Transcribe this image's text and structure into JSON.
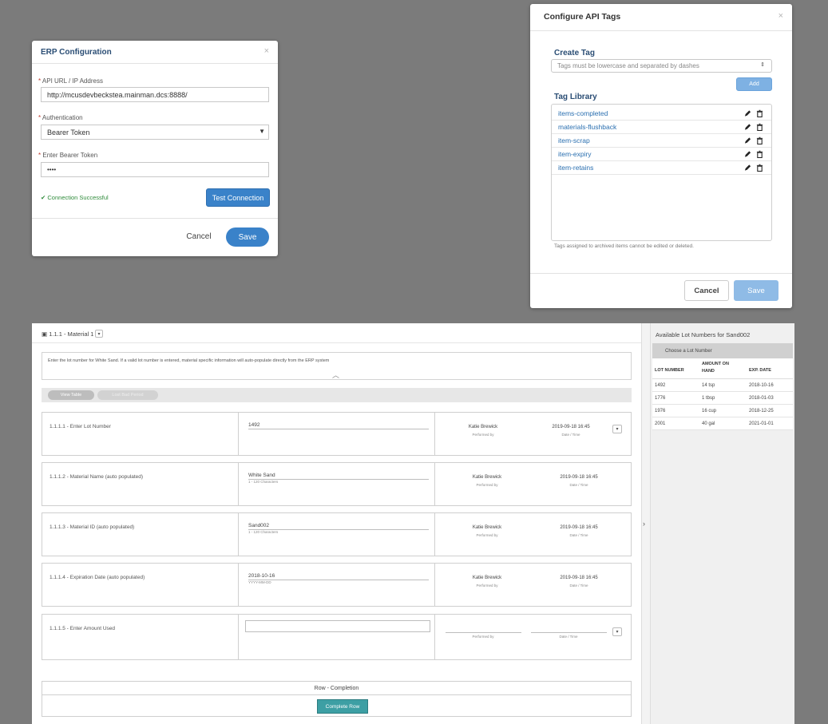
{
  "erp": {
    "title": "ERP Configuration",
    "close": "×",
    "api_label": "API URL / IP Address",
    "api_value": "http://mcusdevbeckstea.mainman.dcs:8888/",
    "auth_label": "Authentication",
    "auth_value": "Bearer Token",
    "token_label": "Enter Bearer Token",
    "token_value": "••••",
    "status": "Connection Successful",
    "test_button": "Test Connection",
    "cancel_button": "Cancel",
    "save_button": "Save",
    "required_mark": "*",
    "accent": "#3a82c9",
    "success_color": "#2e8b3a"
  },
  "tags": {
    "title": "Configure API Tags",
    "close": "×",
    "create_label": "Create Tag",
    "create_placeholder": "Tags must be lowercase and separated by dashes",
    "add_button": "Add",
    "library_label": "Tag Library",
    "items": [
      {
        "label": "items-completed"
      },
      {
        "label": "materials-flushback"
      },
      {
        "label": "item-scrap"
      },
      {
        "label": "item-expiry"
      },
      {
        "label": "item-retains"
      }
    ],
    "note": "Tags assigned to archived items cannot be edited or deleted.",
    "cancel_button": "Cancel",
    "save_button": "Save"
  },
  "workflow": {
    "header": "1.1.1 - Material 1",
    "instruction": "Enter the lot number for White Sand. If a valid lot number is entered, material specific information will auto-populate directly from the ERP system",
    "view_table": "View Table",
    "lot_button": "Lost Bad Period",
    "steps": [
      {
        "label": "1.1.1.1 - Enter Lot Number",
        "value": "1492",
        "hint": "",
        "user": "Katie Brewick",
        "user_sub": "Performed by",
        "date": "2019-09-18 16:45",
        "date_sub": "Date / Time"
      },
      {
        "label": "1.1.1.2 - Material Name (auto populated)",
        "value": "White Sand",
        "hint": "1 - 120 Characters",
        "user": "Katie Brewick",
        "user_sub": "Performed by",
        "date": "2019-09-18 16:45",
        "date_sub": "Date / Time"
      },
      {
        "label": "1.1.1.3 - Material ID (auto populated)",
        "value": "Sand002",
        "hint": "1 - 120 Characters",
        "user": "Katie Brewick",
        "user_sub": "Performed by",
        "date": "2019-09-18 16:45",
        "date_sub": "Date / Time"
      },
      {
        "label": "1.1.1.4 - Expiration Date (auto populated)",
        "value": "2018-10-16",
        "hint": "YYYY-MM-DD",
        "user": "Katie Brewick",
        "user_sub": "Performed by",
        "date": "2019-09-18 16:45",
        "date_sub": "Date / Time"
      },
      {
        "label": "1.1.1.5 - Enter Amount Used",
        "value": "",
        "hint": "",
        "user": "",
        "user_sub": "Performed by",
        "date": "",
        "date_sub": "Date / Time"
      }
    ],
    "row_completion": "Row - Completion",
    "complete_row": "Complete Row"
  },
  "lots": {
    "title": "Available Lot Numbers for Sand002",
    "choose": "Choose a Lot Number",
    "headers": [
      "LOT NUMBER",
      "AMOUNT ON HAND",
      "EXP. DATE"
    ],
    "rows": [
      [
        "1492",
        "14 tsp",
        "2018-10-16"
      ],
      [
        "1776",
        "1 tbsp",
        "2018-01-03"
      ],
      [
        "1976",
        "16 cup",
        "2018-12-25"
      ],
      [
        "2001",
        "40 gal",
        "2021-01-01"
      ]
    ]
  }
}
